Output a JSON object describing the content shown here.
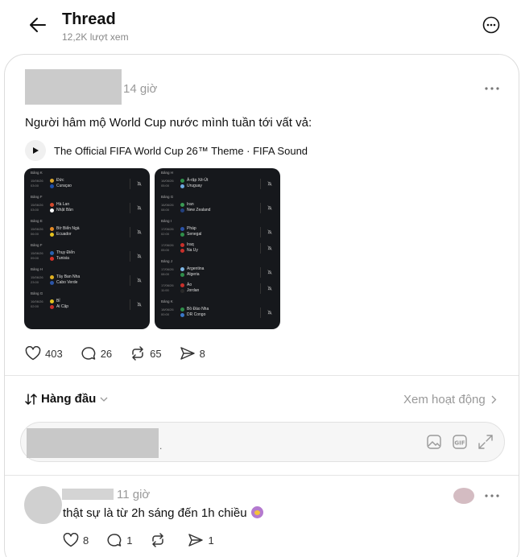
{
  "header": {
    "title": "Thread",
    "views": "12,2K lượt xem",
    "back_icon": "arrow-left-icon",
    "more_icon": "more-circle-icon"
  },
  "post": {
    "time": "14 giờ",
    "text": "Người hâm mộ World Cup nước mình tuần tới vất vả:",
    "music": "The Official FIFA World Cup 26™ Theme · FIFA Sound",
    "image1": {
      "groups": [
        {
          "label": "Bảng K",
          "date": "15/06/26\n03:00",
          "team1": "Đức",
          "team2": "Curaçao",
          "c1": "#d9a52a",
          "c2": "#1f4fa8"
        },
        {
          "label": "Bảng F",
          "date": "15/06/26\n03:00",
          "team1": "Hà Lan",
          "team2": "Nhật Bản",
          "c1": "#d44a2e",
          "c2": "#ffffff"
        },
        {
          "label": "Bảng E",
          "date": "15/06/26\n06:00",
          "team1": "Bờ Biển Ngà",
          "team2": "Ecuador",
          "c1": "#e58a25",
          "c2": "#e4c21f"
        },
        {
          "label": "Bảng F",
          "date": "15/06/26\n09:00",
          "team1": "Thụy Điển",
          "team2": "Tunisia",
          "c1": "#2962b0",
          "c2": "#d8322a"
        },
        {
          "label": "Bảng H",
          "date": "15/06/26\n23:00",
          "team1": "Tây Ban Nha",
          "team2": "Cabo Verde",
          "c1": "#e0b021",
          "c2": "#2b54a7"
        },
        {
          "label": "Bảng G",
          "date": "16/06/26\n02:00",
          "team1": "Bỉ",
          "team2": "Ai Cập",
          "c1": "#e4c21f",
          "c2": "#c8302b"
        }
      ]
    },
    "image2": {
      "groups": [
        {
          "label": "Bảng H",
          "date": "16/06/26\n05:00",
          "team1": "Ả-rập Xê-Út",
          "team2": "Uruguay",
          "c1": "#2f8f4a",
          "c2": "#6da9e0"
        },
        {
          "label": "Bảng G",
          "date": "16/06/26\n08:00",
          "team1": "Iran",
          "team2": "New Zealand",
          "c1": "#3a9a54",
          "c2": "#23407f"
        },
        {
          "label": "Bảng I",
          "date": "17/06/26\n02:00",
          "team1": "Pháp",
          "team2": "Senegal",
          "c1": "#2a52a8",
          "c2": "#2f8f4a"
        },
        {
          "label": "",
          "date": "17/06/26\n05:00",
          "team1": "Iraq",
          "team2": "Na Uy",
          "c1": "#c8302b",
          "c2": "#c8302b"
        },
        {
          "label": "Bảng J",
          "date": "17/06/26\n08:00",
          "team1": "Argentina",
          "team2": "Algeria",
          "c1": "#7db5e4",
          "c2": "#2f8f4a"
        },
        {
          "label": "",
          "date": "17/06/26\n11:00",
          "team1": "Áo",
          "team2": "Jordan",
          "c1": "#c8302b",
          "c2": "#2a2a2a"
        },
        {
          "label": "Bảng K",
          "date": "18/06/26\n00:00",
          "team1": "Bồ Đào Nha",
          "team2": "DR Congo",
          "c1": "#2f8f4a",
          "c2": "#3a77c8"
        }
      ]
    },
    "stats": {
      "likes": "403",
      "comments": "26",
      "reposts": "65",
      "shares": "8"
    }
  },
  "sort": {
    "label": "Hàng đầu",
    "activity_label": "Xem hoạt động"
  },
  "reply": {
    "dot": ".",
    "icons": [
      "image-icon",
      "gif-icon",
      "expand-icon"
    ]
  },
  "comment": {
    "time": "11 giờ",
    "text": "thật sự là từ 2h sáng đến 1h chiều",
    "emoji": "face-emoji-icon",
    "stats": {
      "likes": "8",
      "comments": "1",
      "reposts": "",
      "shares": "1"
    }
  }
}
